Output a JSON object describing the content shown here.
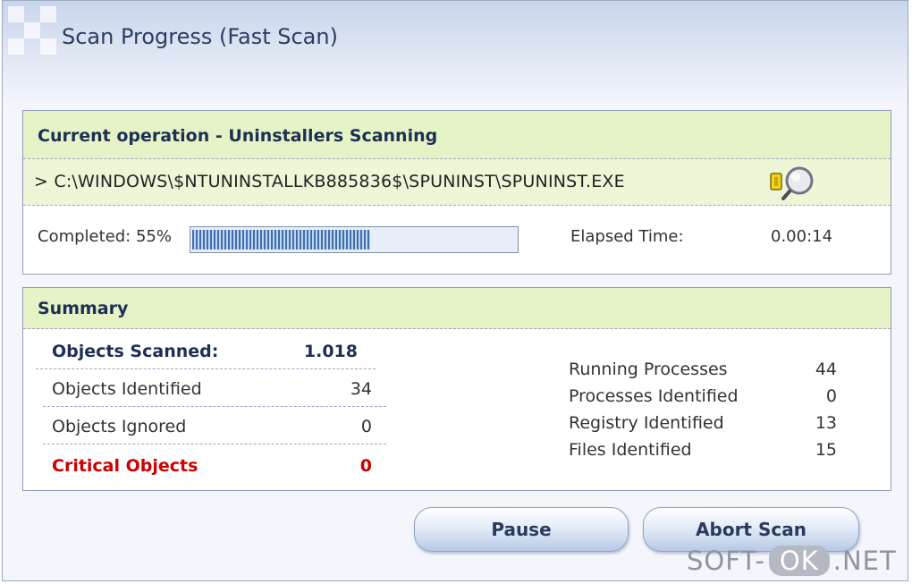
{
  "window": {
    "title": "Scan Progress (Fast Scan)"
  },
  "current": {
    "header": "Current operation - Uninstallers Scanning",
    "path": "> C:\\WINDOWS\\$NTUNINSTALLKB885836$\\SPUNINST\\SPUNINST.EXE",
    "completed_label": "Completed: 55%",
    "progress": 0.55,
    "elapsed_label": "Elapsed Time:",
    "elapsed_value": "0.00:14"
  },
  "summary": {
    "header": "Summary",
    "objects_scanned_label": "Objects Scanned:",
    "objects_scanned_value": "1.018",
    "objects_identified_label": "Objects Identified",
    "objects_identified_value": "34",
    "objects_ignored_label": "Objects Ignored",
    "objects_ignored_value": "0",
    "critical_label": "Critical Objects",
    "critical_value": "0",
    "running_label": "Running Processes",
    "running_value": "44",
    "proc_ident_label": "Processes Identified",
    "proc_ident_value": "0",
    "registry_label": "Registry Identified",
    "registry_value": "13",
    "files_label": "Files Identified",
    "files_value": "15"
  },
  "buttons": {
    "pause": "Pause",
    "abort": "Abort Scan"
  },
  "watermark": {
    "left": "SOFT-",
    "ok": "OK",
    "right": ".NET"
  },
  "colors": {
    "critical": "#cc0000",
    "header_bg": "#e6f3c6"
  }
}
